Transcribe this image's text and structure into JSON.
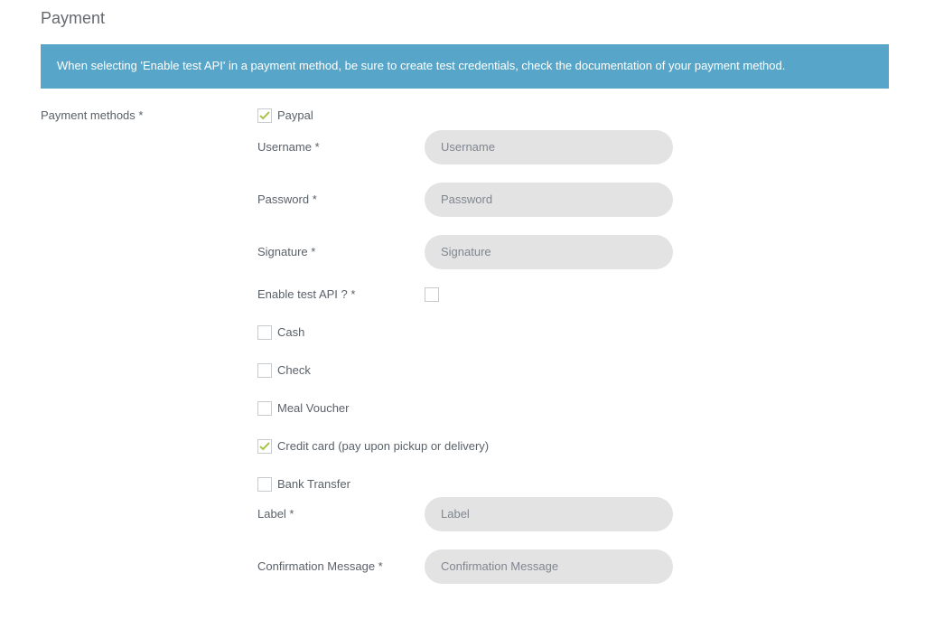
{
  "title": "Payment",
  "alert": "When selecting 'Enable test API' in a payment method, be sure to create test credentials, check the documentation of your payment method.",
  "sideLabel": "Payment methods *",
  "methods": {
    "paypal": {
      "label": "Paypal",
      "checked": true,
      "fields": {
        "username": {
          "label": "Username *",
          "placeholder": "Username"
        },
        "password": {
          "label": "Password *",
          "placeholder": "Password"
        },
        "signature": {
          "label": "Signature *",
          "placeholder": "Signature"
        },
        "testapi": {
          "label": "Enable test API ? *"
        }
      }
    },
    "cash": {
      "label": "Cash",
      "checked": false
    },
    "check": {
      "label": "Check",
      "checked": false
    },
    "meal": {
      "label": "Meal Voucher",
      "checked": false
    },
    "credit": {
      "label": "Credit card (pay upon pickup or delivery)",
      "checked": true
    },
    "bank": {
      "label": "Bank Transfer",
      "checked": false,
      "fields": {
        "labelField": {
          "label": "Label *",
          "placeholder": "Label"
        },
        "confirmation": {
          "label": "Confirmation Message *",
          "placeholder": "Confirmation Message"
        }
      }
    }
  }
}
